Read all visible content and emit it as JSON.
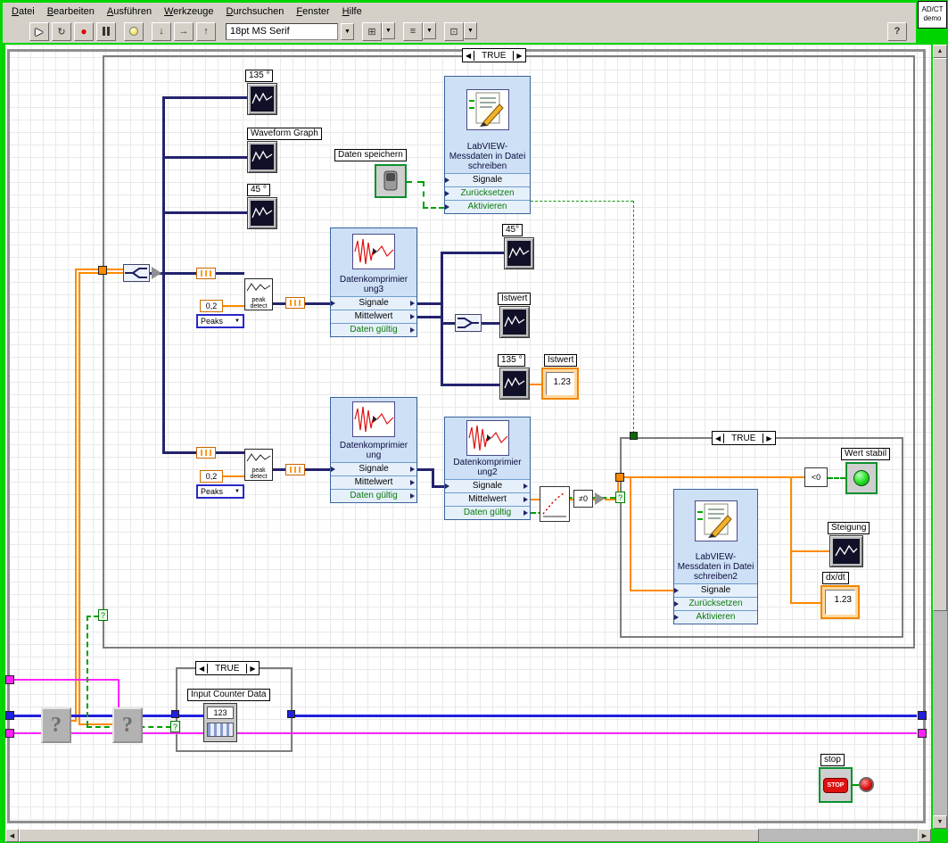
{
  "menubar": {
    "items": [
      "Datei",
      "Bearbeiten",
      "Ausführen",
      "Werkzeuge",
      "Durchsuchen",
      "Fenster",
      "Hilfe"
    ]
  },
  "toolbar": {
    "font_selection": "18pt MS Serif",
    "icons": {
      "run": "▶",
      "run_continuous": "↻",
      "abort": "●",
      "step_into": "↓",
      "step_over": "→",
      "step_out": "↑",
      "align": "⊞",
      "distribute": "≡",
      "reorder": "⊡",
      "dropdown": "▼",
      "help": "?"
    }
  },
  "badge": {
    "line1": "AD/CT",
    "line2": "demo"
  },
  "scrollbar": {
    "up": "▲",
    "down": "▼",
    "left": "◀",
    "right": "▶"
  },
  "cases": {
    "outer": {
      "prev": "◀",
      "label": "TRUE",
      "next": "▶"
    },
    "inner": {
      "prev": "◀",
      "label": "TRUE",
      "next": "▶"
    },
    "bottom": {
      "prev": "◀",
      "label": "TRUE",
      "next": "▶"
    }
  },
  "labels": {
    "graph_135_top": "135 °",
    "waveform_graph": "Waveform Graph",
    "graph_45_top": "45 °",
    "daten_speichern": "Daten speichern",
    "graph_45_mid": "45°",
    "istwert_graph": "Istwert",
    "graph_135_mid": "135 °",
    "istwert_numeric": "Istwert",
    "wert_stabil": "Wert stabil",
    "steigung": "Steigung",
    "dxdt": "dx/dt",
    "stop": "stop",
    "input_counter": "Input Counter Data"
  },
  "values": {
    "istwert": "1.23",
    "dxdt": "1.23",
    "threshold_upper": "0,2",
    "threshold_lower": "0,2",
    "peaks_upper": "Peaks",
    "peaks_lower": "Peaks",
    "stop_button": "STOP",
    "counter_icon": "123",
    "less_than_zero": "<0",
    "not_equal_zero": "≠0",
    "peak_detect_upper": "peak detect",
    "peak_detect_lower": "peak detect",
    "question_vi_1": "?",
    "question_vi_2": "?",
    "selector_glyph": "?"
  },
  "express": {
    "write1": {
      "title": "LabVIEW-Messdaten in Datei schreiben",
      "rows": [
        "Signale",
        "Zurücksetzen",
        "Aktivieren"
      ]
    },
    "komp3": {
      "title": "Datenkomprimier ung3",
      "rows": [
        "Signale",
        "Mittelwert",
        "Daten gültig"
      ]
    },
    "komp": {
      "title": "Datenkomprimier ung",
      "rows": [
        "Signale",
        "Mittelwert",
        "Daten gültig"
      ]
    },
    "komp2": {
      "title": "Datenkomprimier ung2",
      "rows": [
        "Signale",
        "Mittelwert",
        "Daten gültig"
      ]
    },
    "write2": {
      "title": "LabVIEW-Messdaten in Datei schreiben2",
      "rows": [
        "Signale",
        "Zurücksetzen",
        "Aktivieren"
      ]
    }
  },
  "colors": {
    "window_frame": "#00d400",
    "dynamic_wire": "#23236e",
    "dbl_wire": "#ff8a00",
    "boolean_wire": "#00a000",
    "int_wire": "#2020dd",
    "magenta_wire": "#ff22ff",
    "express_bg": "#cde0f6"
  }
}
